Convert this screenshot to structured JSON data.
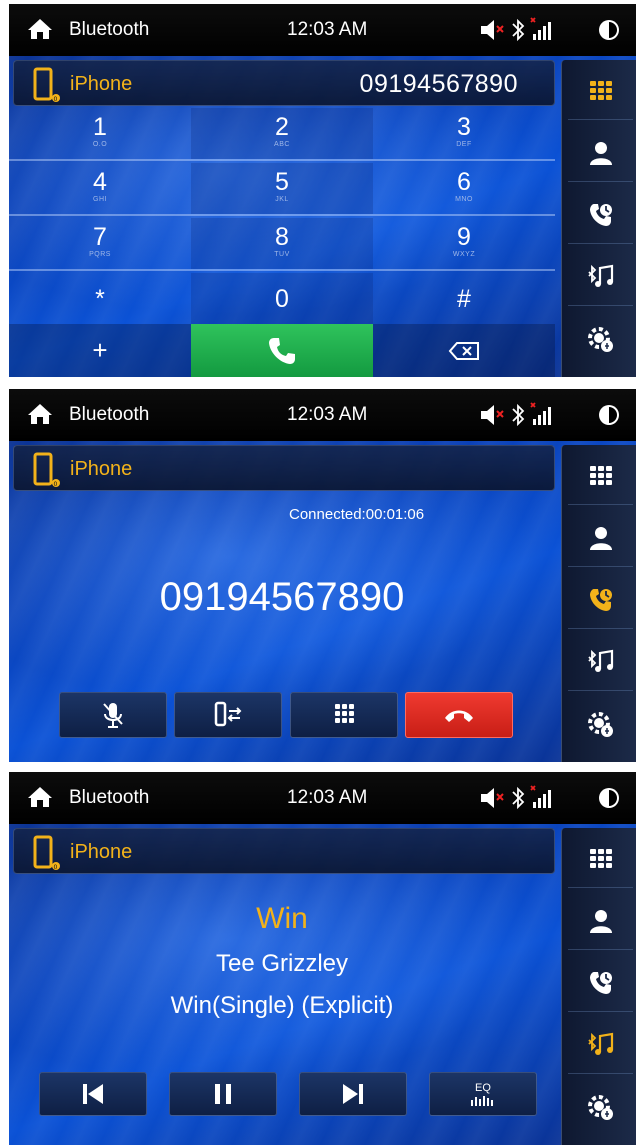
{
  "topbar": {
    "title": "Bluetooth",
    "time": "12:03 AM"
  },
  "device": {
    "name": "iPhone"
  },
  "dialer": {
    "number": "09194567890",
    "keys": [
      {
        "digit": "1",
        "letters": "O.O"
      },
      {
        "digit": "2",
        "letters": "ABC"
      },
      {
        "digit": "3",
        "letters": "DEF"
      },
      {
        "digit": "4",
        "letters": "GHI"
      },
      {
        "digit": "5",
        "letters": "JKL"
      },
      {
        "digit": "6",
        "letters": "MNO"
      },
      {
        "digit": "7",
        "letters": "PQRS"
      },
      {
        "digit": "8",
        "letters": "TUV"
      },
      {
        "digit": "9",
        "letters": "WXYZ"
      },
      {
        "digit": "*",
        "letters": ""
      },
      {
        "digit": "0",
        "letters": ""
      },
      {
        "digit": "#",
        "letters": ""
      }
    ],
    "plus": "+"
  },
  "call": {
    "status": "Connected:00:01:06",
    "number": "09194567890"
  },
  "music": {
    "title": "Win",
    "artist": "Tee Grizzley",
    "album": "Win(Single) (Explicit)",
    "eq_label": "EQ"
  },
  "colors": {
    "accent": "#f2b21a",
    "call_green": "#1aa84a",
    "hangup_red": "#e52a22",
    "active_icon": "#f2b21a",
    "inactive_icon": "#ffffff"
  },
  "sidebar": {
    "items": [
      "keypad-icon",
      "contacts-icon",
      "recent-calls-icon",
      "bt-music-icon",
      "settings-icon"
    ]
  }
}
